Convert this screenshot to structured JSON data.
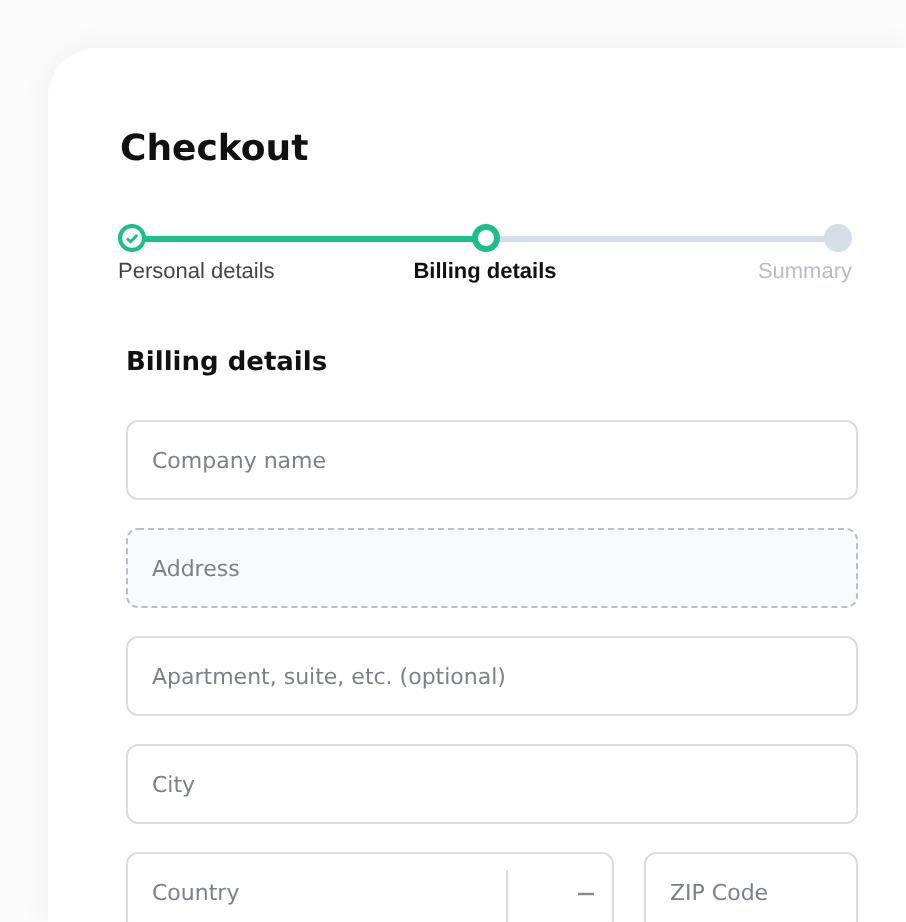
{
  "title": "Checkout",
  "steps": [
    {
      "label": "Personal details",
      "kind": "done"
    },
    {
      "label": "Billing details",
      "kind": "current"
    },
    {
      "label": "Summary",
      "kind": "upcoming"
    }
  ],
  "section_title": "Billing details",
  "rows": [
    [
      {
        "kind": "text",
        "placeholder": "Company name",
        "highlighted": false
      }
    ],
    [
      {
        "kind": "text",
        "placeholder": "Address",
        "highlighted": true
      }
    ],
    [
      {
        "kind": "text",
        "placeholder": "Apartment, suite, etc. (optional)",
        "highlighted": false
      }
    ],
    [
      {
        "kind": "text",
        "placeholder": "City",
        "highlighted": false
      }
    ],
    [
      {
        "kind": "select",
        "placeholder": "Country",
        "highlighted": false
      },
      {
        "kind": "text",
        "placeholder": "ZIP Code",
        "highlighted": false
      }
    ]
  ]
}
